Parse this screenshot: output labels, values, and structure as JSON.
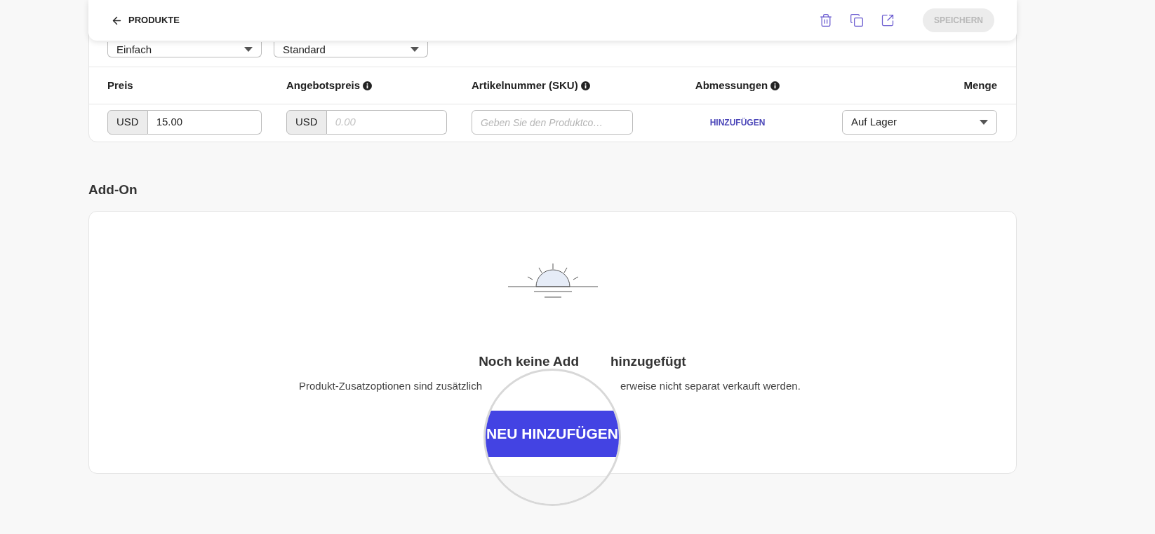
{
  "header": {
    "back_label": "PRODUKTE",
    "save_button": {
      "label": "SPEICHERN",
      "disabled": true
    }
  },
  "selects": [
    {
      "value": "Einfach"
    },
    {
      "value": "Standard"
    }
  ],
  "columns": [
    {
      "label": "Preis",
      "info": false
    },
    {
      "label": "Angebotspreis",
      "info": true
    },
    {
      "label": "Artikelnummer (SKU)",
      "info": true
    },
    {
      "label": "Abmessungen",
      "info": true
    },
    {
      "label": "Menge",
      "info": false
    }
  ],
  "row": {
    "price": {
      "currency": "USD",
      "value": "15.00"
    },
    "offer_price": {
      "currency": "USD",
      "placeholder": "0.00"
    },
    "sku": {
      "placeholder": "Geben Sie den Produktco…"
    },
    "dimensions_button": "HINZUFÜGEN",
    "stock": {
      "value": "Auf Lager"
    }
  },
  "addon": {
    "title": "Add-On",
    "empty": {
      "title_parts": [
        "Noch keine Add",
        "hinzugefügt"
      ],
      "description_parts": [
        "Produkt-Zusatzoptionen sind zusätzlich",
        "erweise nicht separat verkauft werden."
      ],
      "button": "NEU HINZUFÜGEN"
    }
  }
}
